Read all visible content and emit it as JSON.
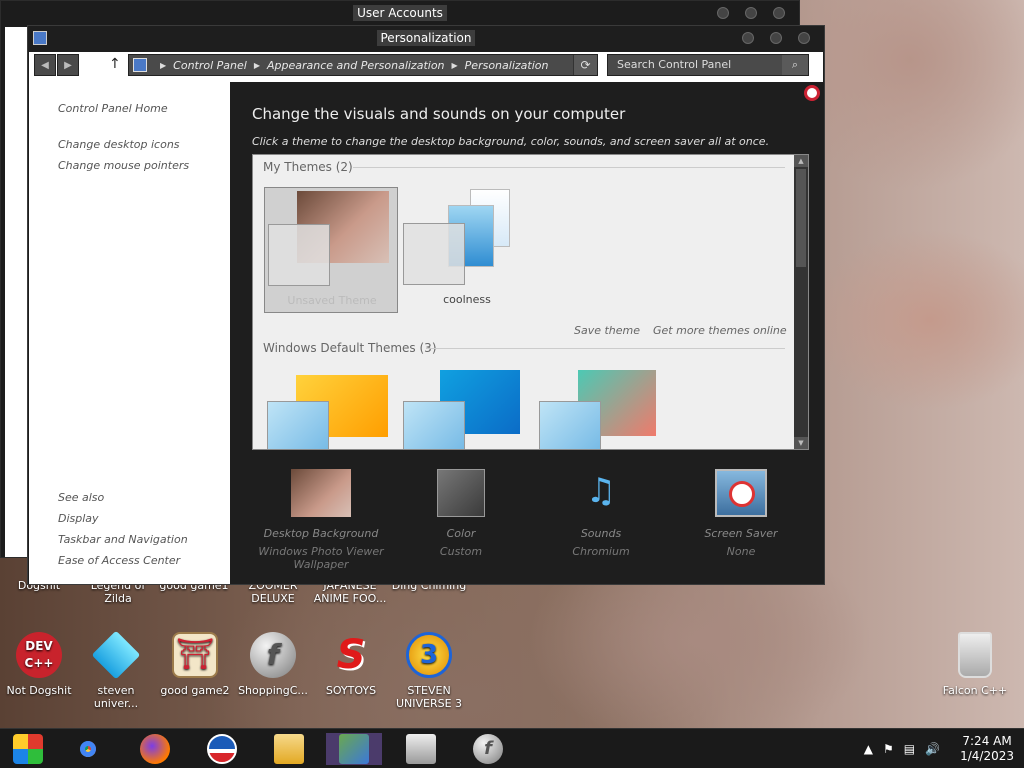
{
  "windows": {
    "user_accounts": {
      "title": "User Accounts"
    },
    "personalization": {
      "title": "Personalization"
    }
  },
  "address_bar": {
    "breadcrumb": [
      "Control Panel",
      "Appearance and Personalization",
      "Personalization"
    ],
    "search_placeholder": "Search Control Panel"
  },
  "left_pane": {
    "links": [
      "Control Panel Home",
      "Change desktop icons",
      "Change mouse pointers"
    ],
    "see_also_label": "See also",
    "see_also": [
      "Display",
      "Taskbar and Navigation",
      "Ease of Access Center"
    ]
  },
  "main": {
    "heading": "Change the visuals and sounds on your computer",
    "subtext": "Click a theme to change the desktop background, color, sounds, and screen saver all at once.",
    "my_themes_label": "My Themes (2)",
    "my_themes": [
      {
        "name": "Unsaved Theme",
        "selected": true
      },
      {
        "name": "coolness",
        "selected": false
      }
    ],
    "save_theme": "Save theme",
    "get_more_themes": "Get more themes online",
    "default_themes_label": "Windows Default Themes (3)"
  },
  "bottom_items": [
    {
      "label": "Desktop Background",
      "sub": "Windows Photo Viewer Wallpaper",
      "icon": "desktop-background-icon"
    },
    {
      "label": "Color",
      "sub": "Custom",
      "icon": "color-icon"
    },
    {
      "label": "Sounds",
      "sub": "Chromium",
      "icon": "sounds-icon"
    },
    {
      "label": "Screen Saver",
      "sub": "None",
      "icon": "screen-saver-icon"
    }
  ],
  "desktop": {
    "partial_labels": [
      "Dogshit",
      "Legend of Zilda",
      "good game1",
      "ZOOMER DELUXE",
      "JAPANESE ANIME FOO...",
      "Ding Chiming"
    ],
    "icons": [
      {
        "name": "Not Dogshit",
        "icon": "dev-cpp-icon"
      },
      {
        "name": "steven univer...",
        "icon": "diamond-icon"
      },
      {
        "name": "good game2",
        "icon": "torii-icon"
      },
      {
        "name": "ShoppingC...",
        "icon": "flash-icon"
      },
      {
        "name": "SOYTOYS",
        "icon": "s-logo-icon"
      },
      {
        "name": "STEVEN UNIVERSE 3",
        "icon": "number-3-icon"
      },
      {
        "name": "Falcon C++",
        "icon": "recycle-bin-icon"
      }
    ]
  },
  "taskbar": {
    "items": [
      "start-icon",
      "chrome-icon",
      "firefox-icon",
      "obama-logo-icon",
      "file-explorer-icon",
      "user-accounts-icon",
      "personalization-icon",
      "flash-icon"
    ],
    "time": "7:24 AM",
    "date": "1/4/2023"
  }
}
